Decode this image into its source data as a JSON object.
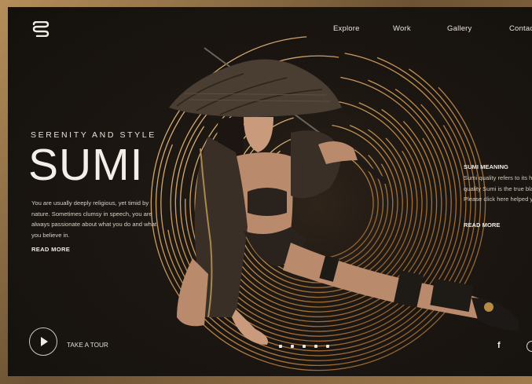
{
  "brand": {
    "logo_icon": "ss-monogram-logo"
  },
  "nav": {
    "items": [
      {
        "label": "Explore"
      },
      {
        "label": "Work"
      },
      {
        "label": "Gallery"
      },
      {
        "label": "Contact"
      }
    ]
  },
  "hero": {
    "tagline": "SERENITY AND STYLE",
    "title": "SUMI",
    "description": "You are usually deeply religious, yet timid by nature. Sometimes clumsy in speech, you are always passionate about what you do and what you believe in.",
    "read_more": "READ MORE"
  },
  "side_panel": {
    "title": "SUMI MEANING",
    "description": "Sumi quality refers to its highest quality Sumi is the true black. Please click here helped you",
    "read_more": "READ MORE"
  },
  "tour": {
    "label": "TAKE A TOUR",
    "icon": "play-icon"
  },
  "pagination": {
    "dot_count": 5
  },
  "social": {
    "facebook_label": "f",
    "instagram_icon": "instagram-icon"
  },
  "colors": {
    "background": "#1a1511",
    "frame_gold": "#b58e5a",
    "ring_gold": "#d9a86a",
    "text_light": "#f0ebe3"
  }
}
